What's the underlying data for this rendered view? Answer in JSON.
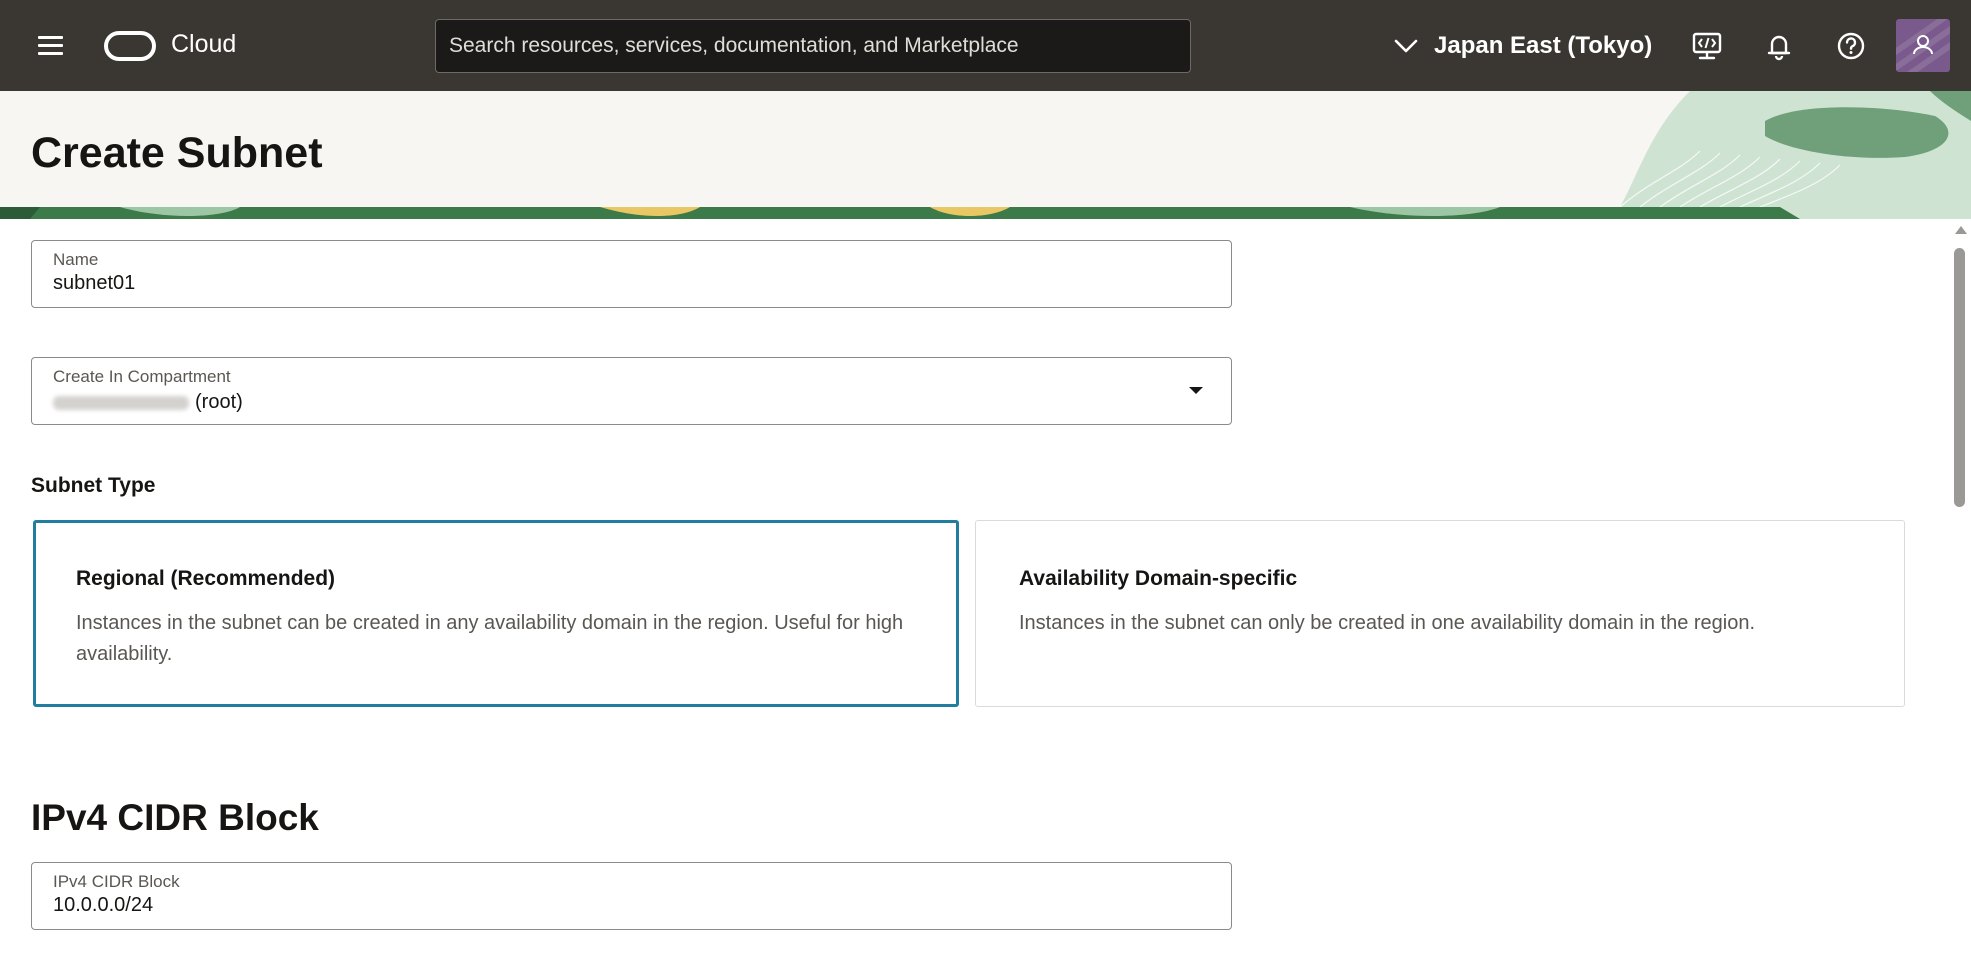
{
  "nav": {
    "brand": "Cloud",
    "search_placeholder": "Search resources, services, documentation, and Marketplace",
    "region": "Japan East (Tokyo)"
  },
  "header": {
    "title": "Create Subnet"
  },
  "form": {
    "name": {
      "label": "Name",
      "value": "subnet01"
    },
    "compartment": {
      "label": "Create In Compartment",
      "value_suffix": "(root)"
    },
    "subnet_type": {
      "label": "Subnet Type",
      "options": [
        {
          "title": "Regional (Recommended)",
          "description": "Instances in the subnet can be created in any availability domain in the region. Useful for high availability.",
          "selected": true
        },
        {
          "title": "Availability Domain-specific",
          "description": "Instances in the subnet can only be created in one availability domain in the region.",
          "selected": false
        }
      ]
    },
    "ipv4_section": {
      "heading": "IPv4 CIDR Block",
      "field": {
        "label": "IPv4 CIDR Block",
        "value": "10.0.0.0/24"
      }
    }
  },
  "colors": {
    "nav_bg": "#3a3632",
    "selected_border": "#227e9e",
    "banner_green": "#3c7a4a",
    "avatar_bg": "#7a5a8c"
  },
  "icons": [
    "hamburger-icon",
    "oracle-logo-icon",
    "chevron-down-icon",
    "cloud-shell-icon",
    "bell-icon",
    "help-icon",
    "user-icon",
    "caret-down-icon"
  ]
}
